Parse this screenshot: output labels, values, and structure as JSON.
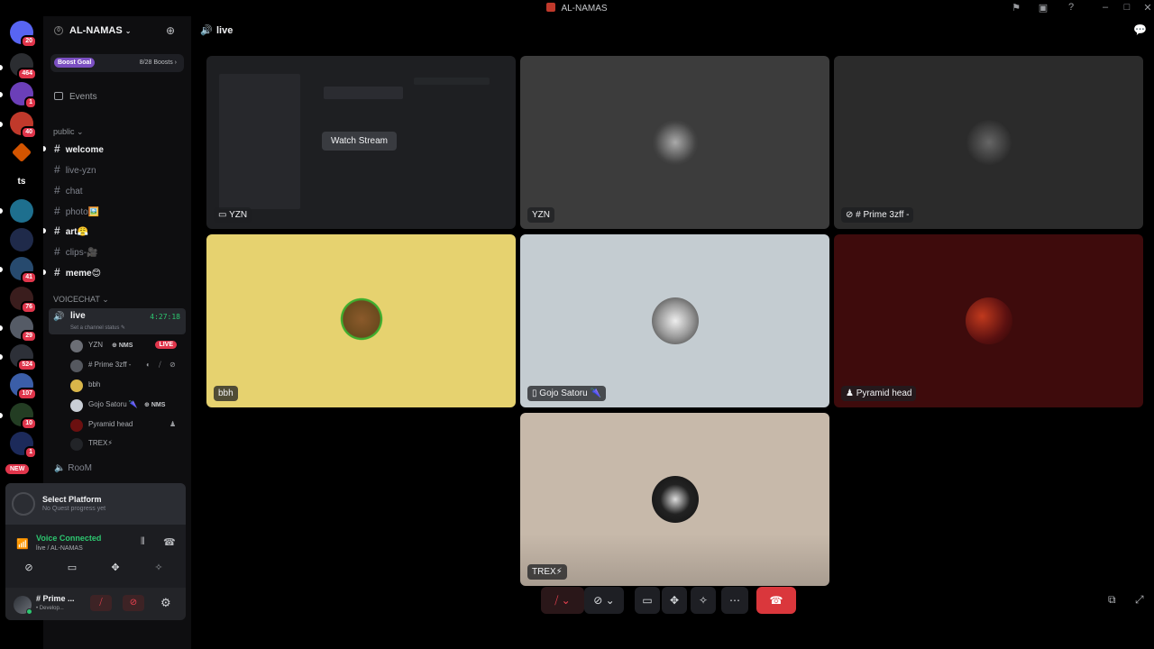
{
  "window": {
    "title": "AL-NAMAS"
  },
  "guilds": {
    "items": [
      {
        "label": "",
        "badge": "20",
        "color": "#5865f2"
      },
      {
        "label": "",
        "badge": "464",
        "color": "#2b2d31"
      },
      {
        "label": "",
        "badge": "1",
        "color": "#6b3fb8"
      },
      {
        "label": "",
        "badge": "40",
        "color": "#c0392b"
      },
      {
        "label": "",
        "badge": "",
        "color": "#d35400"
      },
      {
        "label": "ts",
        "badge": "",
        "color": "#000000"
      },
      {
        "label": "",
        "badge": "",
        "color": "#1e6f8e"
      },
      {
        "label": "",
        "badge": "",
        "color": "#1f2a4a"
      },
      {
        "label": "",
        "badge": "41",
        "color": "#274a6e"
      },
      {
        "label": "",
        "badge": "76",
        "color": "#3a1d1d"
      },
      {
        "label": "",
        "badge": "29",
        "color": "#555b66"
      },
      {
        "label": "",
        "badge": "524",
        "color": "#2d3038"
      },
      {
        "label": "",
        "badge": "107",
        "color": "#3b5ea8"
      },
      {
        "label": "",
        "badge": "10",
        "color": "#233d23"
      },
      {
        "label": "",
        "badge": "1",
        "color": "#1c2a5a"
      }
    ],
    "new_label": "NEW"
  },
  "server": {
    "name": "AL-NAMAS",
    "boost_label": "Boost Goal",
    "boost_count": "8/28 Boosts",
    "events_label": "Events"
  },
  "categories": {
    "public": "public",
    "voice": "VOICECHAT"
  },
  "channels": [
    {
      "name": "welcome",
      "unread": true
    },
    {
      "name": "live-yzn",
      "unread": false
    },
    {
      "name": "chat",
      "unread": false
    },
    {
      "name": "photo🖼️",
      "unread": false
    },
    {
      "name": "art😤",
      "unread": true
    },
    {
      "name": "clips-🎥",
      "unread": false
    },
    {
      "name": "meme😊",
      "unread": true
    }
  ],
  "voice_channel": {
    "name": "live",
    "timer": "4:27:18",
    "status_placeholder": "Set a channel status"
  },
  "voice_users": [
    {
      "name": "YZN",
      "tag": "NMS",
      "live": "LIVE",
      "color": "#6b6e75"
    },
    {
      "name": "# Prime 3zff -",
      "tag": "",
      "live": "",
      "color": "#55585f"
    },
    {
      "name": "bbh",
      "tag": "",
      "live": "",
      "color": "#d9b64a"
    },
    {
      "name": "Gojo Satoru 🌂",
      "tag": "NMS",
      "live": "",
      "color": "#c9ced6"
    },
    {
      "name": "Pyramid head",
      "tag": "",
      "live": "",
      "color": "#6b1010"
    },
    {
      "name": "TREX⚡",
      "tag": "",
      "live": "",
      "color": "#222428"
    }
  ],
  "room_channel": "RooM",
  "quest": {
    "title": "Select Platform",
    "subtitle": "No Quest progress yet"
  },
  "voice_status": {
    "title": "Voice Connected",
    "subtitle": "live / AL-NAMAS"
  },
  "user_panel": {
    "name": "# Prime ...",
    "status": "• Develop..."
  },
  "main": {
    "channel_title": "live"
  },
  "tiles": [
    {
      "label": "YZN",
      "bg": "#1e1f22",
      "watch": "Watch Stream"
    },
    {
      "label": "YZN",
      "bg": "#3c3c3c"
    },
    {
      "label": "# Prime 3zff -",
      "bg": "#2b2b2b"
    },
    {
      "label": "bbh",
      "bg": "#e6d26f"
    },
    {
      "label": "Gojo Satoru 🌂",
      "bg": "#c4ccd1"
    },
    {
      "label": "Pyramid head",
      "bg": "#3e0b0c"
    },
    {
      "label": "TREX⚡",
      "bg": "#c7b9aa"
    }
  ]
}
